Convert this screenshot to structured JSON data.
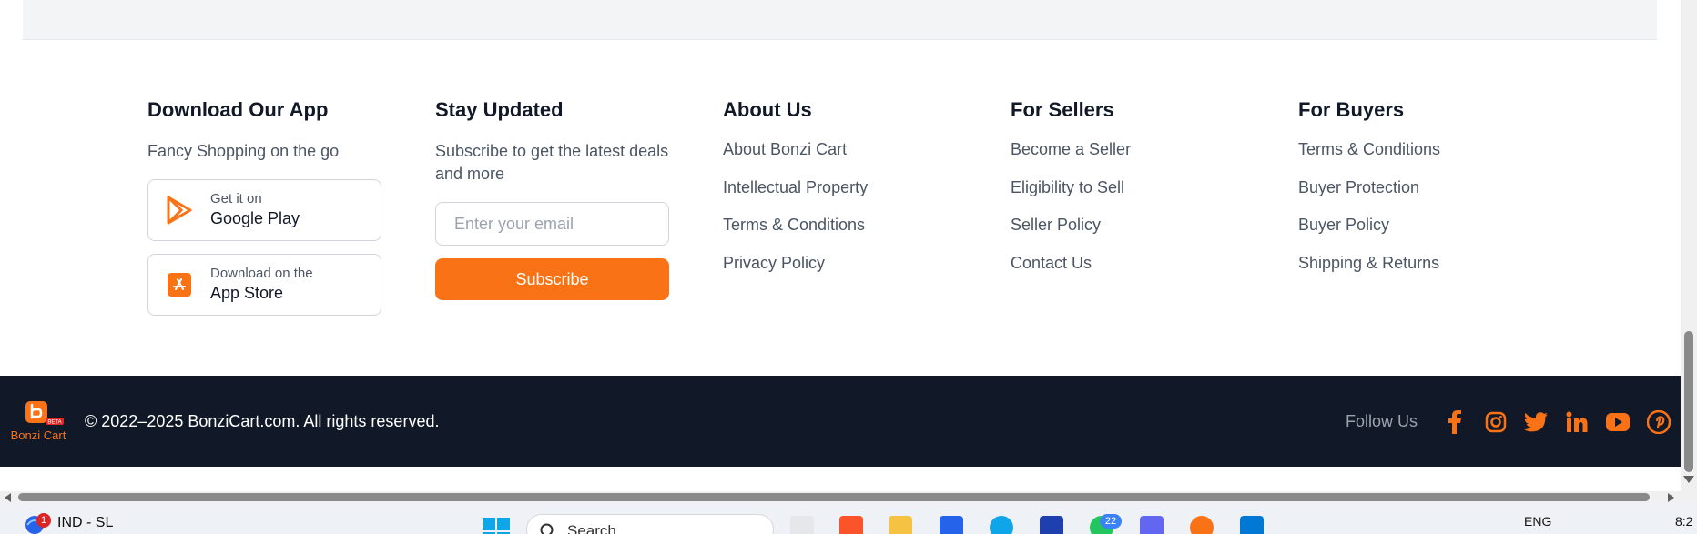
{
  "columns": {
    "app": {
      "title": "Download Our App",
      "subtitle": "Fancy Shopping on the go",
      "google_play": {
        "small": "Get it on",
        "big": "Google Play"
      },
      "app_store": {
        "small": "Download on the",
        "big": "App Store"
      }
    },
    "newsletter": {
      "title": "Stay Updated",
      "subtitle": "Subscribe to get the latest deals and more",
      "email_placeholder": "Enter your email",
      "subscribe_label": "Subscribe"
    },
    "about": {
      "title": "About Us",
      "links": [
        "About Bonzi Cart",
        "Intellectual Property",
        "Terms & Conditions",
        "Privacy Policy"
      ]
    },
    "sellers": {
      "title": "For Sellers",
      "links": [
        "Become a Seller",
        "Eligibility to Sell",
        "Seller Policy",
        "Contact Us"
      ]
    },
    "buyers": {
      "title": "For Buyers",
      "links": [
        "Terms & Conditions",
        "Buyer Protection",
        "Buyer Policy",
        "Shipping & Returns"
      ]
    }
  },
  "bottom_bar": {
    "logo_text": "Bonzi Cart",
    "logo_badge": "BETA",
    "copyright": "© 2022–2025 BonziCart.com. All rights reserved.",
    "follow_label": "Follow Us",
    "social_icons": [
      "facebook-icon",
      "instagram-icon",
      "twitter-icon",
      "linkedin-icon",
      "youtube-icon",
      "pinterest-icon"
    ]
  },
  "taskbar": {
    "notification_badge": "1",
    "status_text": "IND - SL",
    "search_label": "Search",
    "whatsapp_count": "22",
    "language": "ENG",
    "time": "8:2"
  },
  "colors": {
    "accent": "#f97316",
    "footer_dark": "#111827",
    "text_muted": "#4b5563",
    "top_strip": "#f3f4f6"
  }
}
